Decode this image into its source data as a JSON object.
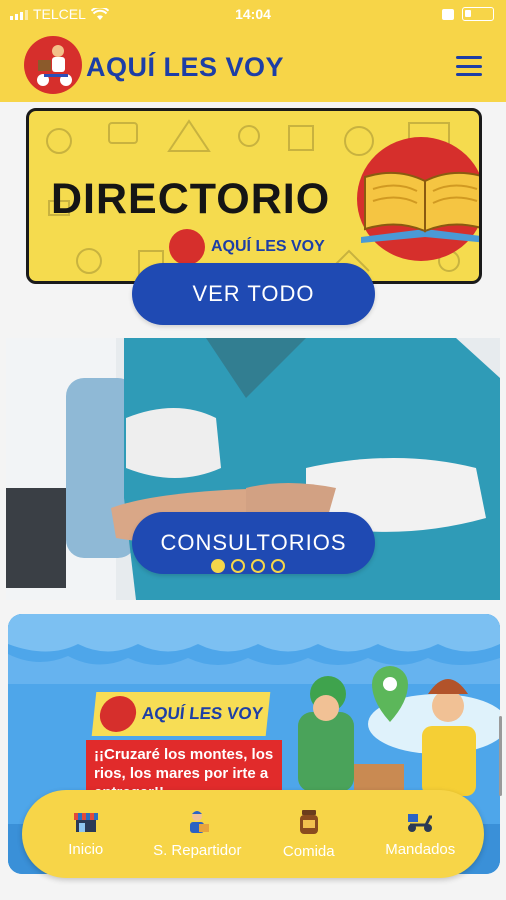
{
  "status_bar": {
    "carrier": "TELCEL",
    "time": "14:04"
  },
  "header": {
    "brand": "AQUÍ LES VOY"
  },
  "directory_banner": {
    "title": "DIRECTORIO",
    "logo_text": "AQUÍ LES VOY",
    "button_label": "VER TODO"
  },
  "carousel": {
    "slide_label": "CONSULTORIOS",
    "dots": [
      true,
      false,
      false,
      false
    ]
  },
  "promo_banner": {
    "logo_text": "AQUÍ LES VOY",
    "tagline": "¡¡Cruzaré los montes, los rios, los mares por irte a entregar!!"
  },
  "bottom_nav": {
    "items": [
      {
        "label": "Inicio",
        "icon": "store-icon"
      },
      {
        "label": "S. Repartidor",
        "icon": "delivery-person-icon"
      },
      {
        "label": "Comida",
        "icon": "food-jar-icon"
      },
      {
        "label": "Mandados",
        "icon": "scooter-icon"
      }
    ]
  },
  "colors": {
    "header_yellow": "#f7d548",
    "brand_blue": "#1d3ea6",
    "button_blue": "#1f4ab3",
    "logo_red": "#d62f2c"
  }
}
